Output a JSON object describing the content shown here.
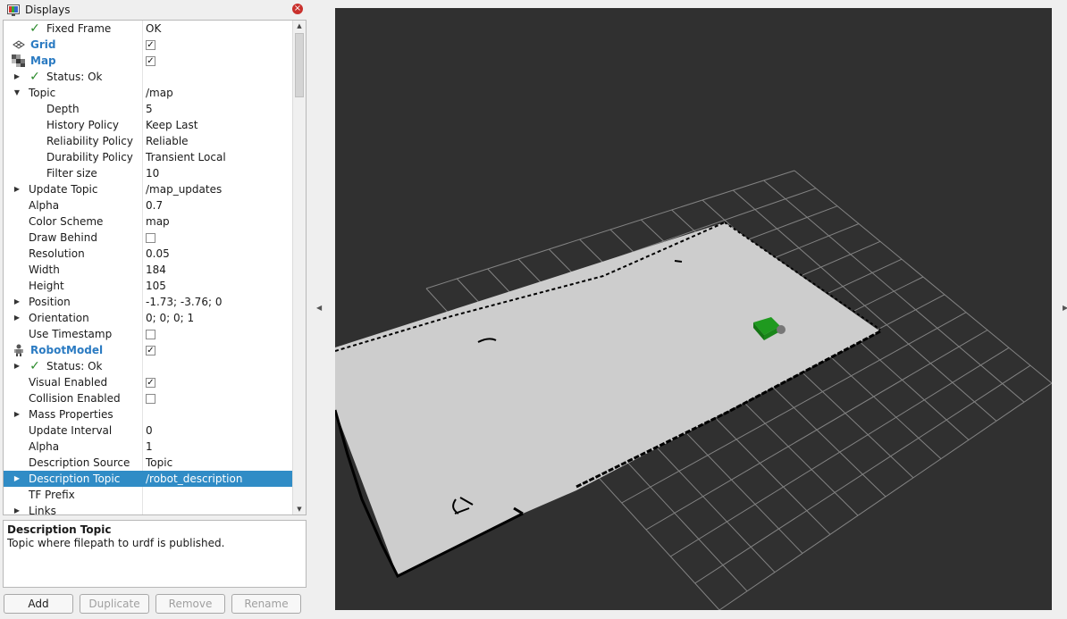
{
  "panel": {
    "title": "Displays",
    "close_glyph": "×"
  },
  "tree": [
    {
      "depth": 1,
      "expander": "",
      "check": true,
      "name": "Fixed Frame",
      "value": "OK"
    },
    {
      "depth": 0,
      "icon": "grid-icon",
      "display": true,
      "name": "Grid",
      "checkbox": true
    },
    {
      "depth": 0,
      "icon": "map-icon",
      "display": true,
      "name": "Map",
      "checkbox": true
    },
    {
      "depth": 1,
      "expander": "collapsed",
      "check": true,
      "name": "Status: Ok",
      "value": ""
    },
    {
      "depth": 1,
      "expander": "expanded",
      "name": "Topic",
      "value": "/map"
    },
    {
      "depth": 2,
      "name": "Depth",
      "value": "5"
    },
    {
      "depth": 2,
      "name": "History Policy",
      "value": "Keep Last"
    },
    {
      "depth": 2,
      "name": "Reliability Policy",
      "value": "Reliable"
    },
    {
      "depth": 2,
      "name": "Durability Policy",
      "value": "Transient Local"
    },
    {
      "depth": 2,
      "name": "Filter size",
      "value": "10"
    },
    {
      "depth": 1,
      "expander": "collapsed",
      "name": "Update Topic",
      "value": "/map_updates"
    },
    {
      "depth": 1,
      "name": "Alpha",
      "value": "0.7"
    },
    {
      "depth": 1,
      "name": "Color Scheme",
      "value": "map"
    },
    {
      "depth": 1,
      "name": "Draw Behind",
      "checkbox": false
    },
    {
      "depth": 1,
      "name": "Resolution",
      "value": "0.05"
    },
    {
      "depth": 1,
      "name": "Width",
      "value": "184"
    },
    {
      "depth": 1,
      "name": "Height",
      "value": "105"
    },
    {
      "depth": 1,
      "expander": "collapsed",
      "name": "Position",
      "value": "-1.73; -3.76; 0"
    },
    {
      "depth": 1,
      "expander": "collapsed",
      "name": "Orientation",
      "value": "0; 0; 0; 1"
    },
    {
      "depth": 1,
      "name": "Use Timestamp",
      "checkbox": false
    },
    {
      "depth": 0,
      "icon": "robot-icon",
      "display": true,
      "name": "RobotModel",
      "checkbox": true
    },
    {
      "depth": 1,
      "expander": "collapsed",
      "check": true,
      "name": "Status: Ok",
      "value": ""
    },
    {
      "depth": 1,
      "name": "Visual Enabled",
      "checkbox": true
    },
    {
      "depth": 1,
      "name": "Collision Enabled",
      "checkbox": false
    },
    {
      "depth": 1,
      "expander": "collapsed",
      "name": "Mass Properties",
      "value": ""
    },
    {
      "depth": 1,
      "name": "Update Interval",
      "value": "0"
    },
    {
      "depth": 1,
      "name": "Alpha",
      "value": "1"
    },
    {
      "depth": 1,
      "name": "Description Source",
      "value": "Topic"
    },
    {
      "depth": 1,
      "expander": "collapsed",
      "name": "Description Topic",
      "value": "/robot_description",
      "selected": true
    },
    {
      "depth": 1,
      "name": "TF Prefix",
      "value": ""
    },
    {
      "depth": 1,
      "expander": "collapsed",
      "name": "Links",
      "value": ""
    }
  ],
  "description": {
    "title": "Description Topic",
    "body": "Topic where filepath to urdf is published."
  },
  "buttons": {
    "add": "Add",
    "duplicate": "Duplicate",
    "remove": "Remove",
    "rename": "Rename"
  },
  "colors": {
    "selection": "#308cc6",
    "display_name": "#2b7bc2",
    "viewport_bg": "#303030",
    "map_free": "#cdcdcd",
    "robot": "#22aa22"
  }
}
